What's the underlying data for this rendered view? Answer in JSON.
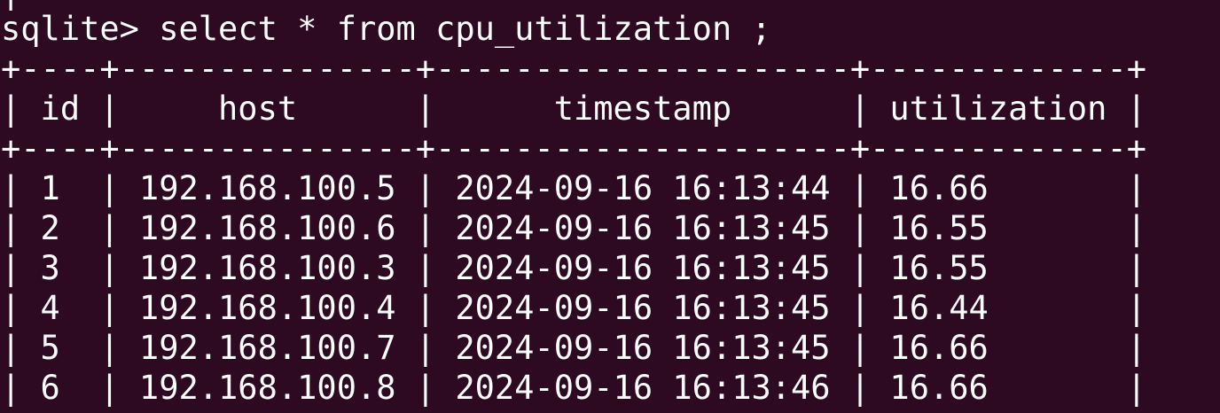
{
  "terminal": {
    "previous_line": "|",
    "prompt": "sqlite>",
    "command": " select * from cpu_utilization ;",
    "border": "+----+---------------+---------------------+-------------+",
    "header_row": "| id |     host      |      timestamp      | utilization |",
    "rows": [
      "| 1  | 192.168.100.5 | 2024-09-16 16:13:44 | 16.66       |",
      "| 2  | 192.168.100.6 | 2024-09-16 16:13:45 | 16.55       |",
      "| 3  | 192.168.100.3 | 2024-09-16 16:13:45 | 16.55       |",
      "| 4  | 192.168.100.4 | 2024-09-16 16:13:45 | 16.44       |",
      "| 5  | 192.168.100.7 | 2024-09-16 16:13:45 | 16.66       |",
      "| 6  | 192.168.100.8 | 2024-09-16 16:13:46 | 16.66       |"
    ]
  },
  "table": {
    "columns": [
      "id",
      "host",
      "timestamp",
      "utilization"
    ],
    "records": [
      [
        "1",
        "192.168.100.5",
        "2024-09-16 16:13:44",
        "16.66"
      ],
      [
        "2",
        "192.168.100.6",
        "2024-09-16 16:13:45",
        "16.55"
      ],
      [
        "3",
        "192.168.100.3",
        "2024-09-16 16:13:45",
        "16.55"
      ],
      [
        "4",
        "192.168.100.4",
        "2024-09-16 16:13:45",
        "16.44"
      ],
      [
        "5",
        "192.168.100.7",
        "2024-09-16 16:13:45",
        "16.66"
      ],
      [
        "6",
        "192.168.100.8",
        "2024-09-16 16:13:46",
        "16.66"
      ]
    ]
  },
  "colors": {
    "background": "#2d0922",
    "text": "#ffffff"
  }
}
